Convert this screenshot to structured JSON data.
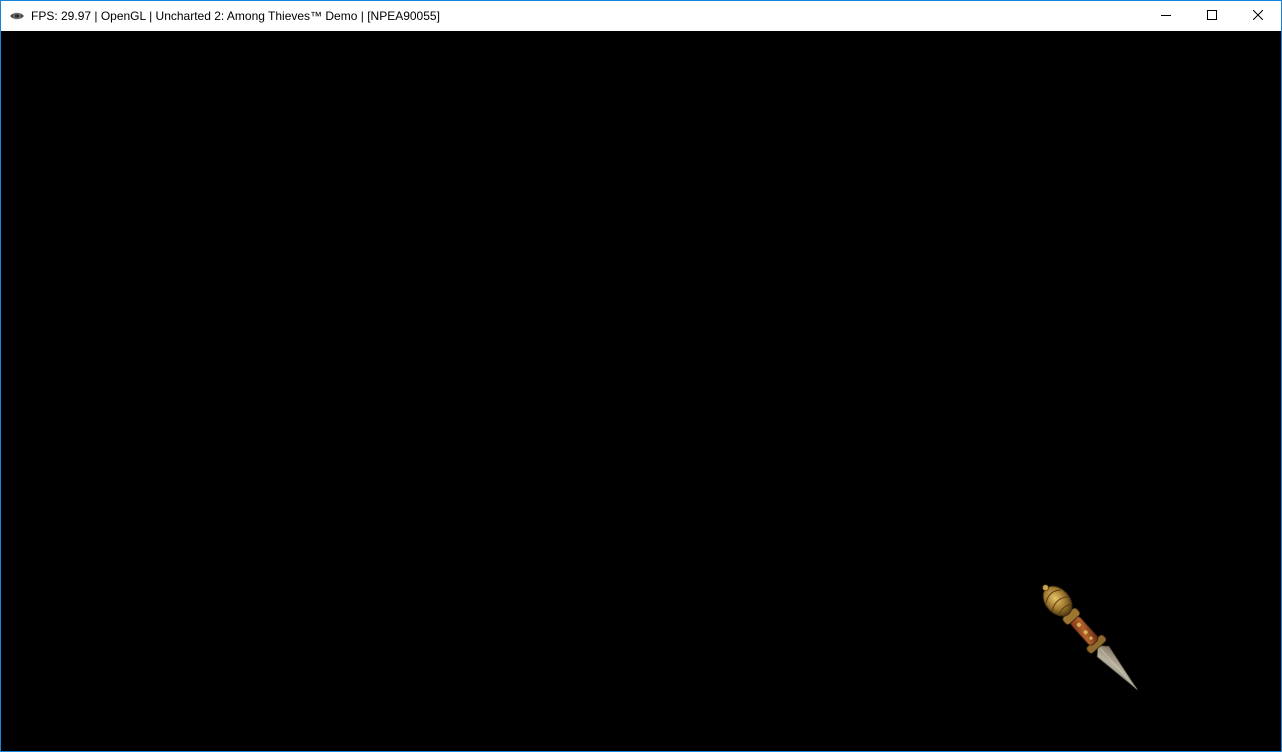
{
  "window": {
    "title": "FPS: 29.97 | OpenGL | Uncharted 2: Among Thieves™ Demo | [NPEA90055]",
    "app_icon": "rpcs3-icon",
    "controls": {
      "minimize": "minimize-icon",
      "maximize": "maximize-icon",
      "close": "close-icon"
    },
    "accent_color": "#1883d7"
  },
  "game_screen": {
    "background_color": "#000000",
    "loading_indicator": "phurba-dagger-icon"
  }
}
